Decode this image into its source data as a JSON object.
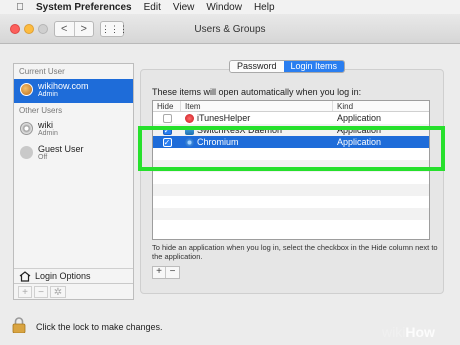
{
  "menubar": {
    "items": [
      "System Preferences",
      "Edit",
      "View",
      "Window",
      "Help"
    ]
  },
  "window": {
    "title": "Users & Groups",
    "nav_back": "<",
    "nav_forward": ">",
    "grid_glyph": "⋮⋮⋮"
  },
  "sidebar": {
    "current_user_label": "Current User",
    "current_user": {
      "name": "wikihow.com",
      "role": "Admin"
    },
    "other_users_label": "Other Users",
    "other_users": [
      {
        "name": "wiki",
        "role": "Admin"
      },
      {
        "name": "Guest User",
        "role": "Off"
      }
    ],
    "login_options": "Login Options",
    "btn_add": "+",
    "btn_remove": "−",
    "btn_gear": "✲"
  },
  "tabs": [
    {
      "label": "Password",
      "active": false
    },
    {
      "label": "Login Items",
      "active": true
    }
  ],
  "login_items": {
    "intro": "These items will open automatically when you log in:",
    "columns": {
      "hide": "Hide",
      "item": "Item",
      "kind": "Kind"
    },
    "rows": [
      {
        "hide": false,
        "item": "iTunesHelper",
        "kind": "Application",
        "icon": "itunes-icon",
        "selected": false
      },
      {
        "hide": true,
        "item": "SwitchResX Daemon",
        "kind": "Application",
        "icon": "switchresx-icon",
        "selected": false
      },
      {
        "hide": true,
        "item": "Chromium",
        "kind": "Application",
        "icon": "chromium-icon",
        "selected": true
      }
    ],
    "hint": "To hide an application when you log in, select the checkbox in the Hide column next to the application.",
    "btn_add": "+",
    "btn_remove": "−"
  },
  "footer": {
    "lock_text": "Click the lock to make changes."
  },
  "watermark": {
    "part1": "wiki",
    "part2": "How"
  },
  "colors": {
    "selection": "#1e6cd9",
    "highlight_box": "#26e02c"
  }
}
